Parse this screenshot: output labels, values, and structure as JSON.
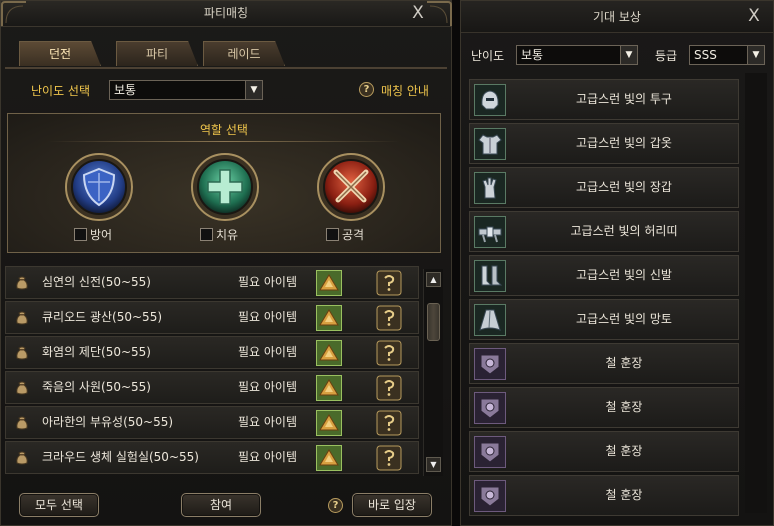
{
  "party_window": {
    "title": "파티매칭",
    "tabs": [
      {
        "label": "던전",
        "active": true
      },
      {
        "label": "파티",
        "active": false
      },
      {
        "label": "레이드",
        "active": false
      }
    ],
    "difficulty_label": "난이도 선택",
    "difficulty_value": "보통",
    "matching_guide_label": "매칭 안내",
    "help_glyph": "?",
    "role_title": "역할 선택",
    "roles": [
      {
        "label": "방어",
        "icon": "shield-icon",
        "checked": false,
        "color": "#3a5fb8"
      },
      {
        "label": "치유",
        "icon": "healing-cross-icon",
        "checked": false,
        "color": "#3f9a77"
      },
      {
        "label": "공격",
        "icon": "crossed-swords-icon",
        "checked": false,
        "color": "#b8321f"
      }
    ],
    "dungeons": [
      {
        "name": "심연의 신전(50~55)",
        "requirement": "필요 아이템"
      },
      {
        "name": "큐리오드 광산(50~55)",
        "requirement": "필요 아이템"
      },
      {
        "name": "화염의 제단(50~55)",
        "requirement": "필요 아이템"
      },
      {
        "name": "죽음의 사원(50~55)",
        "requirement": "필요 아이템"
      },
      {
        "name": "아라한의 부유성(50~55)",
        "requirement": "필요 아이템"
      },
      {
        "name": "크라우드 생체 실험실(50~55)",
        "requirement": "필요 아이템"
      }
    ],
    "buttons": {
      "select_all": "모두 선택",
      "join": "참여",
      "direct_entry": "바로 입장"
    },
    "close_glyph": "X"
  },
  "reward_window": {
    "title": "기대 보상",
    "close_glyph": "X",
    "difficulty_label": "난이도",
    "difficulty_value": "보통",
    "grade_label": "등급",
    "grade_value": "SSS",
    "rewards": [
      {
        "name": "고급스런 빛의 투구",
        "icon": "helmet-icon",
        "rarity": "green"
      },
      {
        "name": "고급스런 빛의 갑옷",
        "icon": "armor-icon",
        "rarity": "green"
      },
      {
        "name": "고급스런 빛의 장갑",
        "icon": "gloves-icon",
        "rarity": "green"
      },
      {
        "name": "고급스런 빛의 허리띠",
        "icon": "belt-icon",
        "rarity": "green"
      },
      {
        "name": "고급스런 빛의 신발",
        "icon": "boots-icon",
        "rarity": "green"
      },
      {
        "name": "고급스런 빛의 망토",
        "icon": "cape-icon",
        "rarity": "green"
      },
      {
        "name": "철 훈장",
        "icon": "medal-icon",
        "rarity": "purple"
      },
      {
        "name": "철 훈장",
        "icon": "medal-icon",
        "rarity": "purple"
      },
      {
        "name": "철 훈장",
        "icon": "medal-icon",
        "rarity": "purple"
      },
      {
        "name": "철 훈장",
        "icon": "medal-icon",
        "rarity": "purple"
      }
    ]
  },
  "colors": {
    "gold_text": "#f0c64c",
    "panel_border": "#6f6148",
    "row_bg": "#24221f"
  }
}
